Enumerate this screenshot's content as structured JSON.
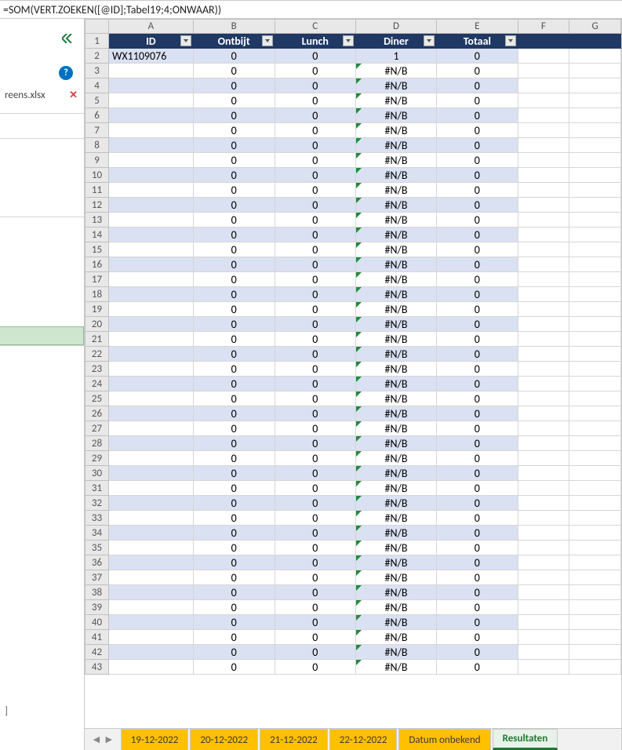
{
  "formula": "=SOM(VERT.ZOEKEN([@ID];Tabel19;4;ONWAAR))",
  "left_panel": {
    "file_name": "reens.xlsx",
    "pin_text": "]"
  },
  "columns": [
    "A",
    "B",
    "C",
    "D",
    "E",
    "F",
    "G"
  ],
  "table_headers": {
    "A": "ID",
    "B": "Ontbijt",
    "C": "Lunch",
    "D": "Diner",
    "E": "Totaal"
  },
  "rows": [
    {
      "n": 2,
      "A": "WX1109076",
      "B": "0",
      "C": "0",
      "D": "1",
      "E": "0"
    },
    {
      "n": 3,
      "A": "",
      "B": "0",
      "C": "0",
      "D": "#N/B",
      "E": "0"
    },
    {
      "n": 4,
      "A": "",
      "B": "0",
      "C": "0",
      "D": "#N/B",
      "E": "0"
    },
    {
      "n": 5,
      "A": "",
      "B": "0",
      "C": "0",
      "D": "#N/B",
      "E": "0"
    },
    {
      "n": 6,
      "A": "",
      "B": "0",
      "C": "0",
      "D": "#N/B",
      "E": "0"
    },
    {
      "n": 7,
      "A": "",
      "B": "0",
      "C": "0",
      "D": "#N/B",
      "E": "0"
    },
    {
      "n": 8,
      "A": "",
      "B": "0",
      "C": "0",
      "D": "#N/B",
      "E": "0"
    },
    {
      "n": 9,
      "A": "",
      "B": "0",
      "C": "0",
      "D": "#N/B",
      "E": "0"
    },
    {
      "n": 10,
      "A": "",
      "B": "0",
      "C": "0",
      "D": "#N/B",
      "E": "0"
    },
    {
      "n": 11,
      "A": "",
      "B": "0",
      "C": "0",
      "D": "#N/B",
      "E": "0"
    },
    {
      "n": 12,
      "A": "",
      "B": "0",
      "C": "0",
      "D": "#N/B",
      "E": "0"
    },
    {
      "n": 13,
      "A": "",
      "B": "0",
      "C": "0",
      "D": "#N/B",
      "E": "0"
    },
    {
      "n": 14,
      "A": "",
      "B": "0",
      "C": "0",
      "D": "#N/B",
      "E": "0"
    },
    {
      "n": 15,
      "A": "",
      "B": "0",
      "C": "0",
      "D": "#N/B",
      "E": "0"
    },
    {
      "n": 16,
      "A": "",
      "B": "0",
      "C": "0",
      "D": "#N/B",
      "E": "0"
    },
    {
      "n": 17,
      "A": "",
      "B": "0",
      "C": "0",
      "D": "#N/B",
      "E": "0"
    },
    {
      "n": 18,
      "A": "",
      "B": "0",
      "C": "0",
      "D": "#N/B",
      "E": "0"
    },
    {
      "n": 19,
      "A": "",
      "B": "0",
      "C": "0",
      "D": "#N/B",
      "E": "0"
    },
    {
      "n": 20,
      "A": "",
      "B": "0",
      "C": "0",
      "D": "#N/B",
      "E": "0"
    },
    {
      "n": 21,
      "A": "",
      "B": "0",
      "C": "0",
      "D": "#N/B",
      "E": "0"
    },
    {
      "n": 22,
      "A": "",
      "B": "0",
      "C": "0",
      "D": "#N/B",
      "E": "0"
    },
    {
      "n": 23,
      "A": "",
      "B": "0",
      "C": "0",
      "D": "#N/B",
      "E": "0"
    },
    {
      "n": 24,
      "A": "",
      "B": "0",
      "C": "0",
      "D": "#N/B",
      "E": "0"
    },
    {
      "n": 25,
      "A": "",
      "B": "0",
      "C": "0",
      "D": "#N/B",
      "E": "0"
    },
    {
      "n": 26,
      "A": "",
      "B": "0",
      "C": "0",
      "D": "#N/B",
      "E": "0"
    },
    {
      "n": 27,
      "A": "",
      "B": "0",
      "C": "0",
      "D": "#N/B",
      "E": "0"
    },
    {
      "n": 28,
      "A": "",
      "B": "0",
      "C": "0",
      "D": "#N/B",
      "E": "0"
    },
    {
      "n": 29,
      "A": "",
      "B": "0",
      "C": "0",
      "D": "#N/B",
      "E": "0"
    },
    {
      "n": 30,
      "A": "",
      "B": "0",
      "C": "0",
      "D": "#N/B",
      "E": "0"
    },
    {
      "n": 31,
      "A": "",
      "B": "0",
      "C": "0",
      "D": "#N/B",
      "E": "0"
    },
    {
      "n": 32,
      "A": "",
      "B": "0",
      "C": "0",
      "D": "#N/B",
      "E": "0"
    },
    {
      "n": 33,
      "A": "",
      "B": "0",
      "C": "0",
      "D": "#N/B",
      "E": "0"
    },
    {
      "n": 34,
      "A": "",
      "B": "0",
      "C": "0",
      "D": "#N/B",
      "E": "0"
    },
    {
      "n": 35,
      "A": "",
      "B": "0",
      "C": "0",
      "D": "#N/B",
      "E": "0"
    },
    {
      "n": 36,
      "A": "",
      "B": "0",
      "C": "0",
      "D": "#N/B",
      "E": "0"
    },
    {
      "n": 37,
      "A": "",
      "B": "0",
      "C": "0",
      "D": "#N/B",
      "E": "0"
    },
    {
      "n": 38,
      "A": "",
      "B": "0",
      "C": "0",
      "D": "#N/B",
      "E": "0"
    },
    {
      "n": 39,
      "A": "",
      "B": "0",
      "C": "0",
      "D": "#N/B",
      "E": "0"
    },
    {
      "n": 40,
      "A": "",
      "B": "0",
      "C": "0",
      "D": "#N/B",
      "E": "0"
    },
    {
      "n": 41,
      "A": "",
      "B": "0",
      "C": "0",
      "D": "#N/B",
      "E": "0"
    },
    {
      "n": 42,
      "A": "",
      "B": "0",
      "C": "0",
      "D": "#N/B",
      "E": "0"
    },
    {
      "n": 43,
      "A": "",
      "B": "0",
      "C": "0",
      "D": "#N/B",
      "E": "0"
    }
  ],
  "sheet_tabs": [
    {
      "label": "19-12-2022",
      "active": false
    },
    {
      "label": "20-12-2022",
      "active": false
    },
    {
      "label": "21-12-2022",
      "active": false
    },
    {
      "label": "22-12-2022",
      "active": false
    },
    {
      "label": "Datum onbekend",
      "active": false
    },
    {
      "label": "Resultaten",
      "active": true
    }
  ],
  "status_text": ""
}
